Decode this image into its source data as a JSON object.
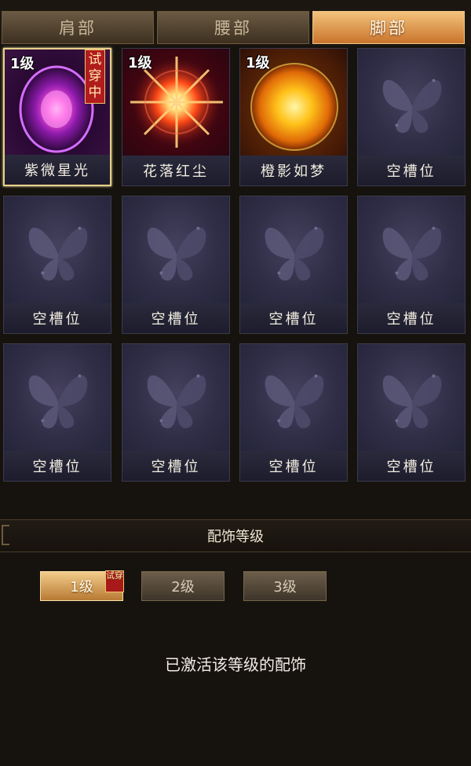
{
  "tabs": [
    {
      "label": "肩部",
      "active": false
    },
    {
      "label": "腰部",
      "active": false
    },
    {
      "label": "脚部",
      "active": true
    }
  ],
  "slots": [
    {
      "level": "1级",
      "name": "紫微星光",
      "icon": "purple-vortex-icon",
      "tag": "试穿中",
      "selected": true
    },
    {
      "level": "1级",
      "name": "花落红尘",
      "icon": "red-starburst-icon"
    },
    {
      "level": "1级",
      "name": "橙影如梦",
      "icon": "golden-sun-icon"
    },
    {
      "name": "空槽位",
      "icon": "butterfly-icon"
    },
    {
      "name": "空槽位",
      "icon": "butterfly-icon"
    },
    {
      "name": "空槽位",
      "icon": "butterfly-icon"
    },
    {
      "name": "空槽位",
      "icon": "butterfly-icon"
    },
    {
      "name": "空槽位",
      "icon": "butterfly-icon"
    },
    {
      "name": "空槽位",
      "icon": "butterfly-icon"
    },
    {
      "name": "空槽位",
      "icon": "butterfly-icon"
    },
    {
      "name": "空槽位",
      "icon": "butterfly-icon"
    },
    {
      "name": "空槽位",
      "icon": "butterfly-icon"
    }
  ],
  "level_section": {
    "title": "配饰等级",
    "buttons": [
      {
        "label": "1级",
        "active": true,
        "tag": "试穿"
      },
      {
        "label": "2级",
        "active": false
      },
      {
        "label": "3级",
        "active": false
      }
    ],
    "status": "已激活该等级的配饰"
  },
  "colors": {
    "accent": "#e2a055",
    "slot_bg": "#242438",
    "try_tag": "#b11c1c"
  }
}
